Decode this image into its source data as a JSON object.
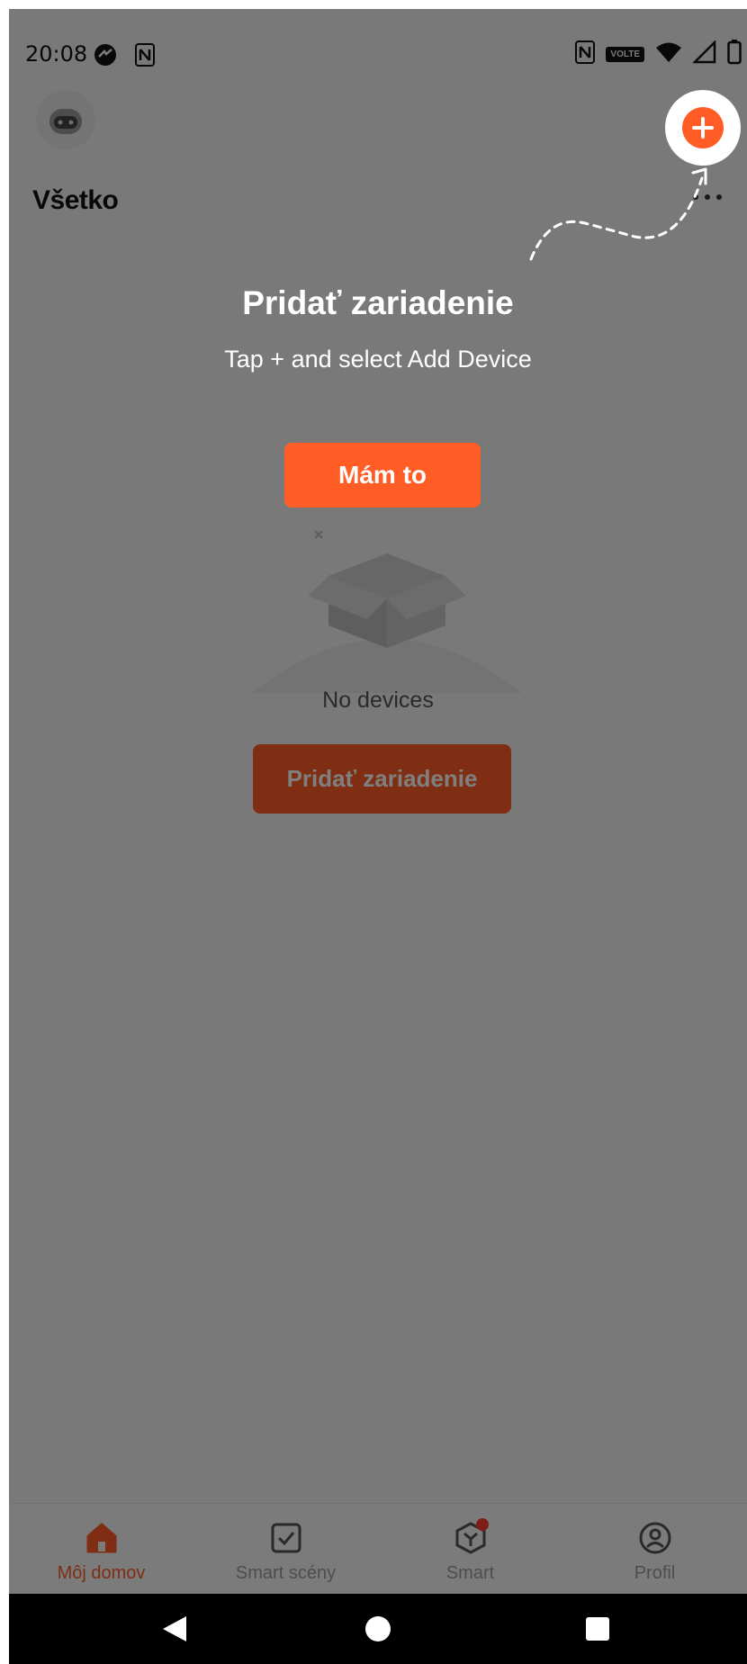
{
  "status_bar": {
    "time": "20:08",
    "volte_label": "VOLTE"
  },
  "header": {
    "home_title": "Všetko"
  },
  "empty_state": {
    "message": "No devices",
    "add_device_label": "Pridať zariadenie"
  },
  "guide": {
    "title": "Pridať zariadenie",
    "subtitle": "Tap + and select Add Device",
    "got_it_label": "Mám to"
  },
  "tabs": [
    {
      "label": "Môj domov",
      "icon": "home-icon",
      "active": true
    },
    {
      "label": "Smart scény",
      "icon": "scene-check-icon",
      "active": false
    },
    {
      "label": "Smart",
      "icon": "smart-cube-icon",
      "active": false,
      "badge": true
    },
    {
      "label": "Profil",
      "icon": "profile-icon",
      "active": false
    }
  ],
  "colors": {
    "accent": "#ff5c26",
    "overlay": "rgba(0,0,0,0.5)",
    "badge": "#ff3b30"
  }
}
